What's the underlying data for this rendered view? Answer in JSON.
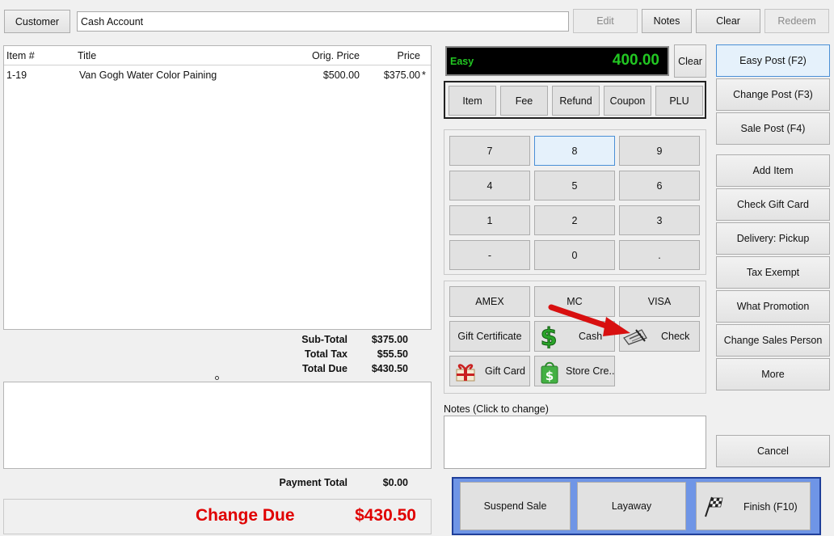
{
  "top_bar": {
    "customer_label": "Customer",
    "account_value": "Cash Account",
    "edit_label": "Edit",
    "notes_label": "Notes",
    "clear_label": "Clear",
    "redeem_label": "Redeem"
  },
  "items_table": {
    "columns": [
      "Item #",
      "Title",
      "Orig. Price",
      "Price"
    ],
    "rows": [
      {
        "item_no": "1-19",
        "title": "Van Gogh Water Color Paining",
        "orig_price": "$500.00",
        "price": "$375.00",
        "flag": "*"
      }
    ]
  },
  "totals": {
    "subtotal_label": "Sub-Total",
    "subtotal_value": "$375.00",
    "tax_label": "Total Tax",
    "tax_value": "$55.50",
    "due_label": "Total Due",
    "due_value": "$430.50"
  },
  "payment": {
    "total_label": "Payment Total",
    "total_value": "$0.00",
    "change_label": "Change Due",
    "change_value": "$430.50"
  },
  "display": {
    "mode": "Easy",
    "amount": "400.00",
    "clear_label": "Clear"
  },
  "line_types": [
    "Item",
    "Fee",
    "Refund",
    "Coupon",
    "PLU"
  ],
  "keypad": [
    "7",
    "8",
    "9",
    "4",
    "5",
    "6",
    "1",
    "2",
    "3",
    "-",
    "0",
    "."
  ],
  "tenders": {
    "amex": "AMEX",
    "mc": "MC",
    "visa": "VISA",
    "gift_certificate": "Gift Certificate",
    "cash": "Cash",
    "check": "Check",
    "gift_card": "Gift Card",
    "store_credit": "Store Cre..."
  },
  "notes": {
    "label": "Notes (Click to change)",
    "value": ""
  },
  "sidebar": {
    "easy_post": "Easy Post (F2)",
    "change_post": "Change Post (F3)",
    "sale_post": "Sale Post (F4)",
    "add_item": "Add Item",
    "check_gift_card": "Check Gift Card",
    "delivery": "Delivery: Pickup",
    "tax_exempt": "Tax Exempt",
    "what_promotion": "What Promotion",
    "change_sales_person": "Change Sales Person",
    "more": "More",
    "cancel": "Cancel"
  },
  "bottom_actions": {
    "suspend": "Suspend Sale",
    "layaway": "Layaway",
    "finish": "Finish (F10)"
  },
  "colors": {
    "change_due": "#e00000",
    "display_bg": "#000000",
    "display_text": "#22c722",
    "bottom_panel": "#6f95e6",
    "arrow": "#e01010"
  }
}
